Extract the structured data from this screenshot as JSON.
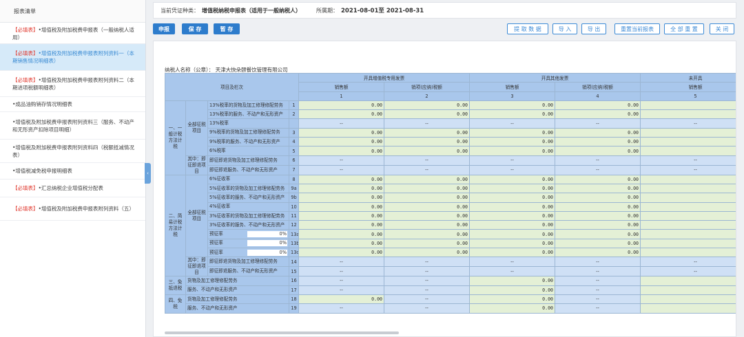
{
  "sidebar": {
    "title": "报表清单",
    "items": [
      {
        "tag": "【必填表】",
        "text": "•增值税及附加税费申报表（一般纳税人适用）"
      },
      {
        "tag": "【必填表】",
        "text": "•增值税及附加税费申报表附列资料一（本期销售情况明细表）"
      },
      {
        "tag": "【必填表】",
        "text": "•增值税及附加税费申报表附列资料二（本期进项税额明细表）"
      },
      {
        "tag": "",
        "text": "•成品油购销存情况明细表"
      },
      {
        "tag": "",
        "text": "•增值税及附加税费申报表附列资料三（服务、不动产和无形资产扣除项目明细）"
      },
      {
        "tag": "",
        "text": "•增值税及附加税费申报表附列资料四（税额抵减情况表）"
      },
      {
        "tag": "",
        "text": "•增值税减免税申报明细表"
      },
      {
        "tag": "【必填表】",
        "text": "•汇总纳税企业增值税分配表"
      },
      {
        "tag": "【必填表】",
        "text": "•增值税及附加税费申报表附列资料（五）"
      }
    ],
    "collapse_icon": "‹"
  },
  "header": {
    "voucher_label": "当前凭证种类：",
    "voucher_value": "增值税纳税申报表（适用于一般纳税人）",
    "period_label": "所属期：",
    "period_value": "2021-08-01至 2021-08-31"
  },
  "toolbar": {
    "declare": "申报",
    "save": "保 存",
    "temp_save": "暂 存",
    "fetch": "提 取 数 据",
    "import": "导 入",
    "export": "导 出",
    "reset_current": "重置当前报表",
    "reset_all": "全 部 重 置",
    "close": "关 闭"
  },
  "form": {
    "taxpayer": "纳税人名称（公章）：   天津大快朵颐餐饮管理有限公司",
    "items_header": "项目及栏次",
    "groups": [
      "开具增值税专用发票",
      "开具其他发票",
      "未开具"
    ],
    "sub": [
      "销售额",
      "销项(应纳)税额",
      "销售额",
      "销项(应纳)税额",
      "销售额"
    ],
    "colnums": [
      "1",
      "2",
      "3",
      "4",
      "5"
    ],
    "sec1": "一、一般计税方法计税",
    "sec1a": "全部征税项目",
    "sec1b": "其中：即征即退项目",
    "sec2": "二、简易计税方法计税",
    "sec2a": "全部征税项目",
    "sec2b": "其中：即征即退项目",
    "sec3": "三、免抵退税",
    "sec4": "四、免税",
    "zero": "0.00",
    "dash": "--",
    "rows": [
      {
        "label": "13%税率的货物及加工修理修配劳务",
        "num": "1",
        "cells": [
          "g",
          "g",
          "g",
          "g",
          "g"
        ]
      },
      {
        "label": "13%税率的服务、不动产和无形资产",
        "num": "2",
        "cells": [
          "g",
          "g",
          "g",
          "g",
          "g"
        ]
      },
      {
        "label": "13%税率",
        "num": "",
        "cells": [
          "b",
          "b",
          "b",
          "b",
          "b"
        ]
      },
      {
        "label": "9%税率的货物及加工修理修配劳务",
        "num": "3",
        "cells": [
          "g",
          "g",
          "g",
          "g",
          "g"
        ]
      },
      {
        "label": "9%税率的服务、不动产和无形资产",
        "num": "4",
        "cells": [
          "g",
          "g",
          "g",
          "g",
          "g"
        ]
      },
      {
        "label": "6%税率",
        "num": "5",
        "cells": [
          "g",
          "g",
          "g",
          "g",
          "g"
        ]
      },
      {
        "label": "即征即退货物及加工修理修配劳务",
        "num": "6",
        "cells": [
          "b",
          "b",
          "b",
          "b",
          "b"
        ]
      },
      {
        "label": "即征即退服务、不动产和无形资产",
        "num": "7",
        "cells": [
          "b",
          "b",
          "b",
          "b",
          "b"
        ]
      },
      {
        "label": "6%征收率",
        "num": "8",
        "cells": [
          "g",
          "g",
          "g",
          "g",
          "g"
        ]
      },
      {
        "label": "5%征收率的货物及加工修理修配劳务",
        "num": "9a",
        "cells": [
          "g",
          "g",
          "g",
          "g",
          "g"
        ]
      },
      {
        "label": "5%征收率的服务、不动产和无形资产",
        "num": "9b",
        "cells": [
          "g",
          "g",
          "g",
          "g",
          "g"
        ]
      },
      {
        "label": "4%征收率",
        "num": "10",
        "cells": [
          "g",
          "g",
          "g",
          "g",
          "g"
        ]
      },
      {
        "label": "3%征收率的货物及加工修理修配劳务",
        "num": "11",
        "cells": [
          "g",
          "g",
          "g",
          "g",
          "g"
        ]
      },
      {
        "label": "3%征收率的服务、不动产和无形资产",
        "num": "12",
        "cells": [
          "g",
          "g",
          "g",
          "g",
          "g"
        ]
      },
      {
        "label": "预征率",
        "rate": "0%",
        "num": "13a",
        "cells": [
          "g",
          "g",
          "g",
          "g",
          "g"
        ]
      },
      {
        "label": "预征率",
        "rate": "0%",
        "num": "13b",
        "cells": [
          "g",
          "g",
          "g",
          "g",
          "g"
        ]
      },
      {
        "label": "预征率",
        "rate": "0%",
        "num": "13c",
        "cells": [
          "g",
          "g",
          "g",
          "g",
          "g"
        ]
      },
      {
        "label": "即征即退货物及加工修理修配劳务",
        "num": "14",
        "cells": [
          "b",
          "b",
          "b",
          "b",
          "b"
        ]
      },
      {
        "label": "即征即退服务、不动产和无形资产",
        "num": "15",
        "cells": [
          "b",
          "b",
          "b",
          "b",
          "b"
        ]
      },
      {
        "label": "货物及加工修理修配劳务",
        "num": "16",
        "cells": [
          "b",
          "b",
          "g",
          "b",
          "g"
        ]
      },
      {
        "label": "服务、不动产和无形资产",
        "num": "17",
        "cells": [
          "b",
          "b",
          "g",
          "b",
          "g"
        ]
      },
      {
        "label": "货物及加工修理修配劳务",
        "num": "18",
        "cells": [
          "g",
          "b",
          "g",
          "b",
          "g"
        ]
      },
      {
        "label": "服务、不动产和无形资产",
        "num": "19",
        "cells": [
          "b",
          "b",
          "g",
          "b",
          "g"
        ]
      }
    ]
  }
}
